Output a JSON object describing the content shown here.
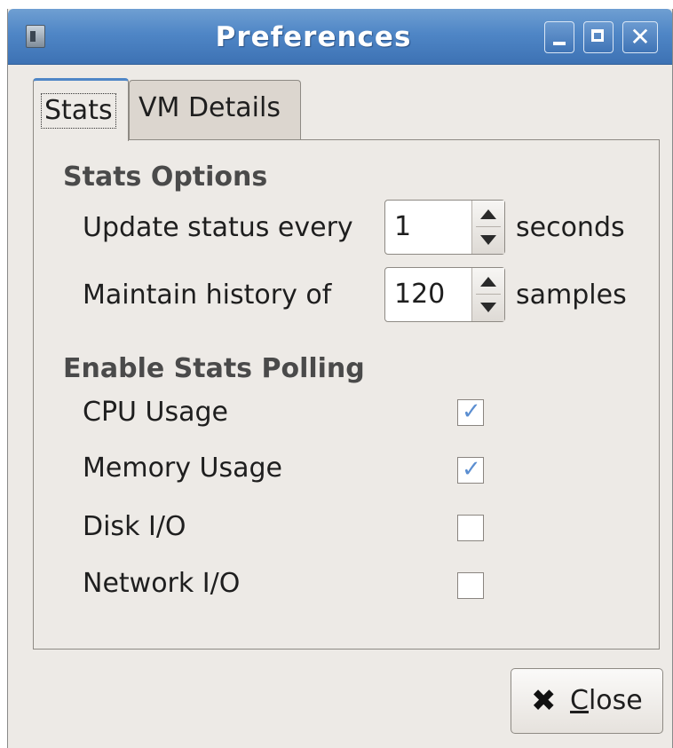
{
  "window": {
    "title": "Preferences"
  },
  "tabs": [
    {
      "label": "Stats",
      "selected": true
    },
    {
      "label": "VM Details",
      "selected": false
    }
  ],
  "stats_options": {
    "heading": "Stats Options",
    "update": {
      "label": "Update status every",
      "value": "1",
      "unit": "seconds"
    },
    "history": {
      "label": "Maintain history of",
      "value": "120",
      "unit": "samples"
    }
  },
  "polling": {
    "heading": "Enable Stats Polling",
    "items": [
      {
        "label": "CPU Usage",
        "checked": true
      },
      {
        "label": "Memory Usage",
        "checked": true
      },
      {
        "label": "Disk I/O",
        "checked": false
      },
      {
        "label": "Network I/O",
        "checked": false
      }
    ]
  },
  "close_button": {
    "mnemonic": "C",
    "rest": "lose"
  },
  "colors": {
    "titlebar": "#4f86c6",
    "background": "#edeae6",
    "check": "#5b8ed1"
  }
}
